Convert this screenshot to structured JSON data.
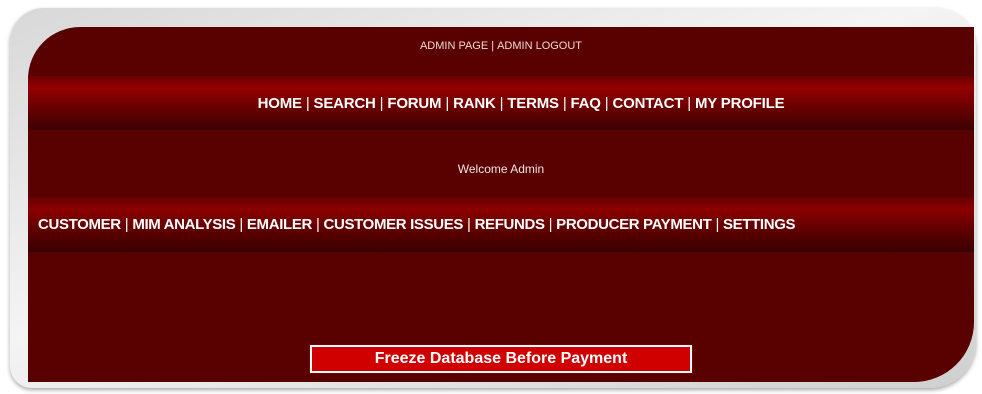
{
  "top_links": [
    {
      "label": "ADMIN PAGE"
    },
    {
      "label": "ADMIN LOGOUT"
    }
  ],
  "main_nav": [
    {
      "label": "HOME"
    },
    {
      "label": "SEARCH"
    },
    {
      "label": "FORUM"
    },
    {
      "label": "RANK"
    },
    {
      "label": "TERMS"
    },
    {
      "label": "FAQ"
    },
    {
      "label": "CONTACT"
    },
    {
      "label": "MY PROFILE"
    }
  ],
  "welcome_text": "Welcome Admin",
  "admin_nav": [
    {
      "label": "CUSTOMER"
    },
    {
      "label": "MIM ANALYSIS"
    },
    {
      "label": "EMAILER"
    },
    {
      "label": "CUSTOMER ISSUES"
    },
    {
      "label": "REFUNDS"
    },
    {
      "label": "PRODUCER PAYMENT"
    },
    {
      "label": "SETTINGS"
    }
  ],
  "separator": "|",
  "freeze_button_label": "Freeze Database Before Payment",
  "colors": {
    "panel_background": "#590000",
    "button_background": "#d10000",
    "text": "#ffffff"
  }
}
